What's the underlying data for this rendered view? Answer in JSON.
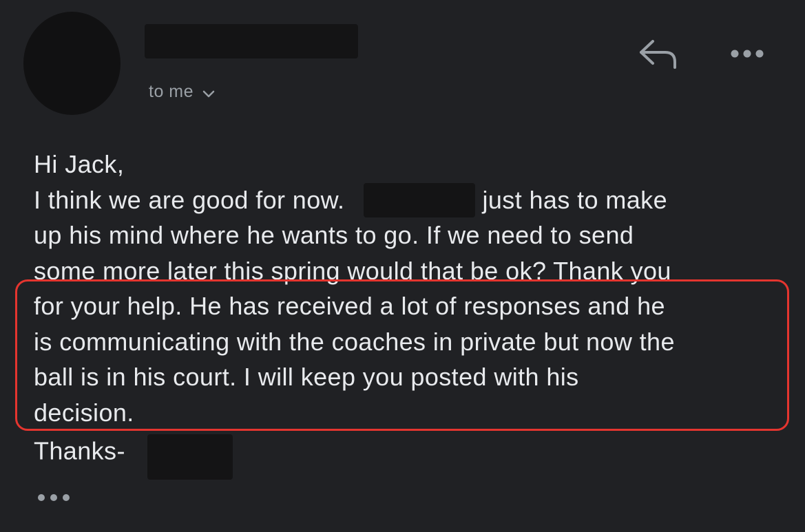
{
  "message": {
    "recipient_label": "to me",
    "greeting": "Hi Jack,",
    "body_lines": [
      "I think we are good for now.",
      "just has to make",
      "up his mind where he wants to go.  If we need to send",
      "some more later this spring would that be ok?  Thank you",
      "for your help.  He has received a lot of responses and he",
      "is communicating with the coaches in private but now the",
      "ball is in his court.  I will keep you posted with his",
      "decision."
    ],
    "signoff": "Thanks-"
  },
  "icons": {
    "reply": "reply-arrow-icon",
    "more": "more-horizontal-icon",
    "expand": "ellipsis-icon",
    "recipient_toggle": "chevron-down-icon"
  },
  "colors": {
    "background": "#202124",
    "text": "#e8eaed",
    "secondary_text": "#9aa0a6",
    "redaction": "#141415",
    "highlight": "#e5352f"
  }
}
